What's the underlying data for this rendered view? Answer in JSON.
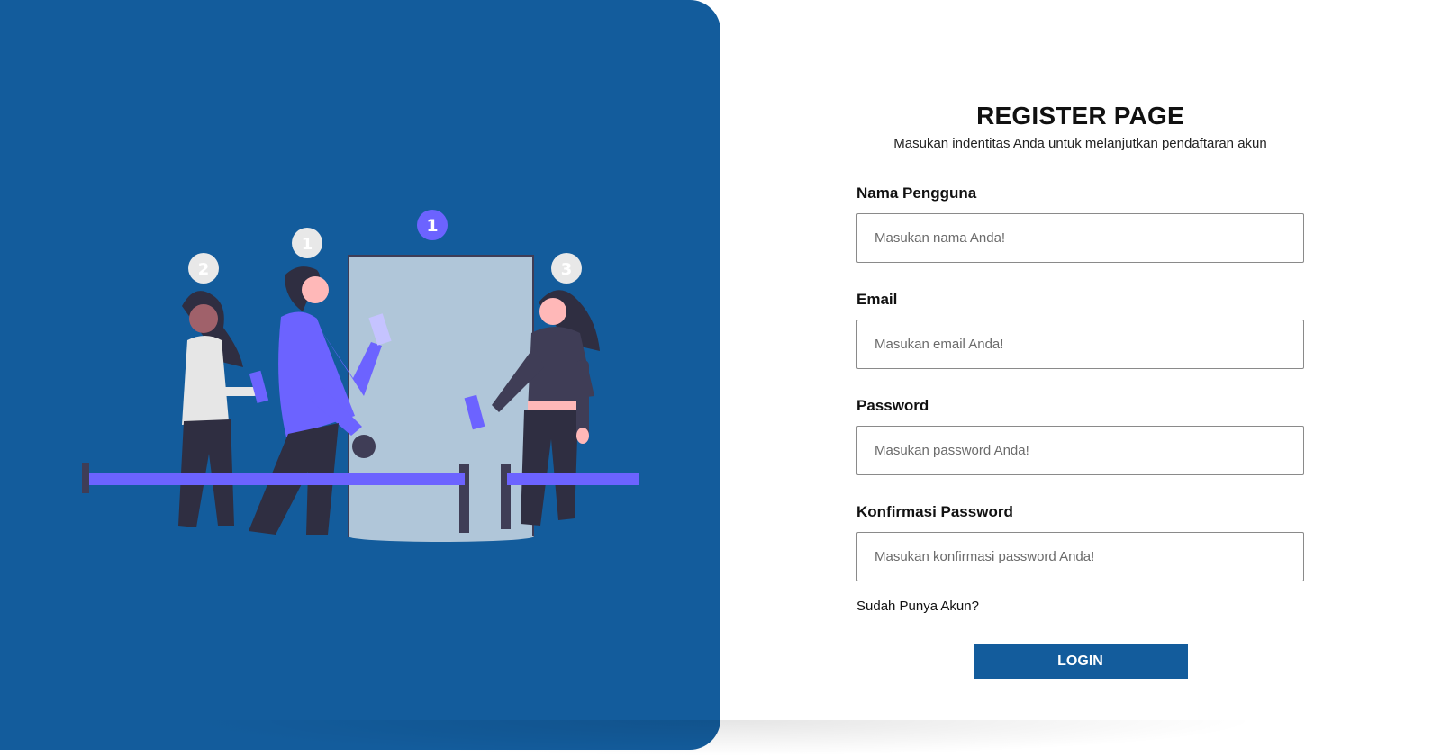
{
  "colors": {
    "brand": "#135c9c",
    "accent_purple": "#6c63ff",
    "door": "#b0c6d9",
    "dark_clothes": "#2f2e41"
  },
  "illustration": {
    "icon": "queue-people-illustration",
    "queue_badges": [
      "1",
      "1",
      "2",
      "3"
    ]
  },
  "form": {
    "title": "REGISTER PAGE",
    "subtitle": "Masukan indentitas Anda untuk melanjutkan pendaftaran akun",
    "fields": [
      {
        "label": "Nama Pengguna",
        "placeholder": "Masukan nama Anda!",
        "value": ""
      },
      {
        "label": "Email",
        "placeholder": "Masukan email Anda!",
        "value": ""
      },
      {
        "label": "Password",
        "placeholder": "Masukan password Anda!",
        "value": ""
      },
      {
        "label": "Konfirmasi Password",
        "placeholder": "Masukan konfirmasi password Anda!",
        "value": ""
      }
    ],
    "login_link": "Sudah Punya Akun?",
    "submit_label": "LOGIN"
  }
}
